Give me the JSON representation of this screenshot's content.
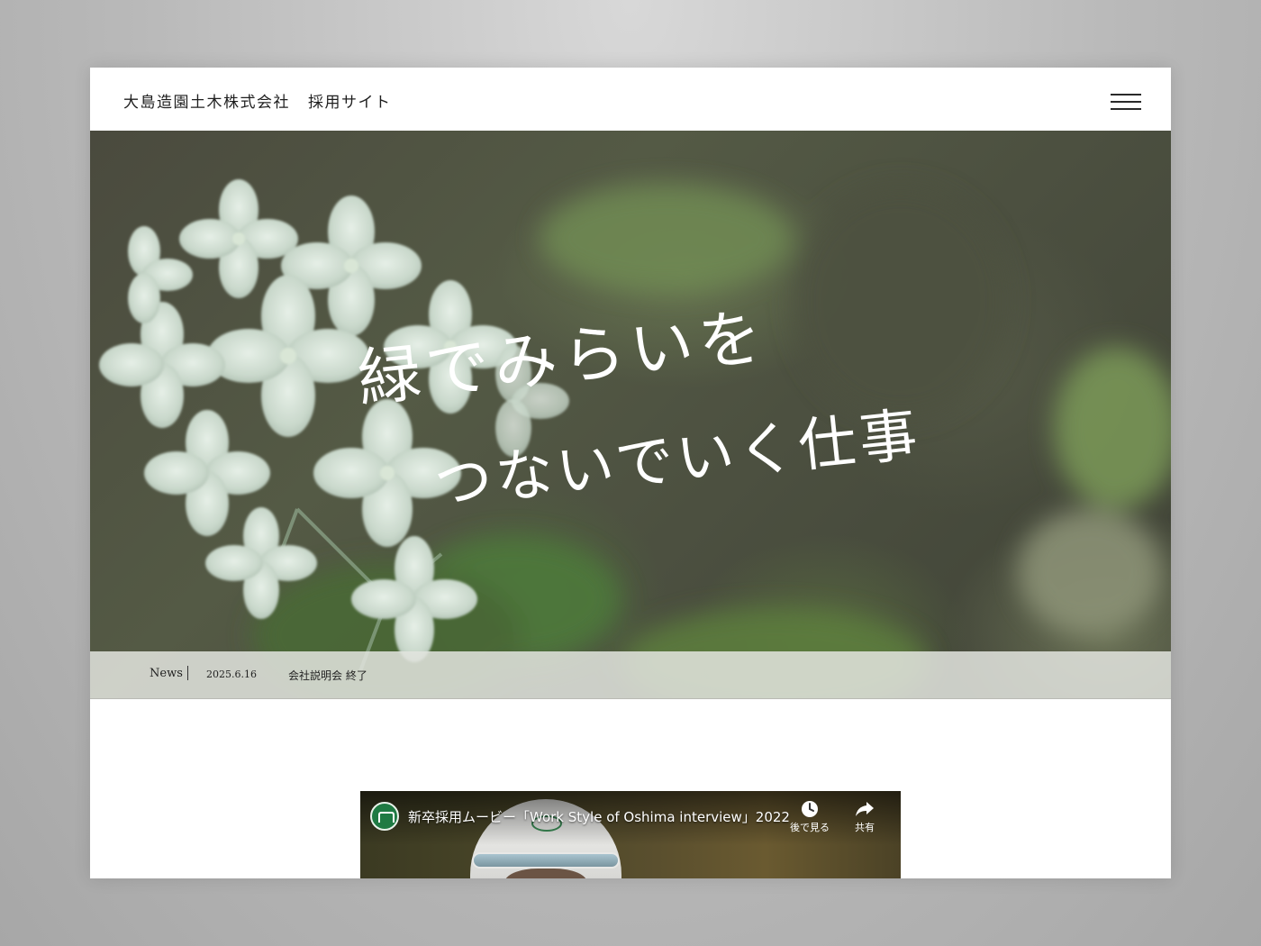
{
  "header": {
    "company": "大島造園土木株式会社",
    "subtitle": "採用サイト",
    "menu_icon": "hamburger-menu-icon"
  },
  "hero": {
    "catchphrase_line1": "緑でみらいを",
    "catchphrase_line2": "つないでいく仕事"
  },
  "news": {
    "label": "News",
    "date": "2025.6.16",
    "text": "会社説明会 終了"
  },
  "video": {
    "title": "新卒採用ムービー「Work Style of Oshima interview」2022",
    "watch_later": "後で見る",
    "share": "共有",
    "icons": {
      "channel": "channel-logo-icon",
      "watch_later": "clock-icon",
      "share": "share-arrow-icon"
    }
  },
  "colors": {
    "background": "#b9b9b9",
    "header_bg": "#ffffff",
    "news_bar_bg": "#e2e4de",
    "channel_green": "#1f7a43"
  }
}
